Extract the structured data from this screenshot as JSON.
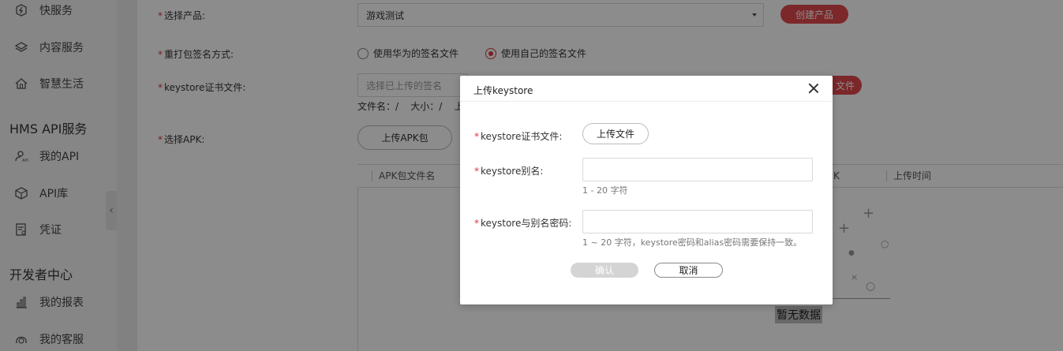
{
  "sidebar": {
    "items_top": [
      {
        "label": "快服务",
        "icon": "quick-service-icon"
      },
      {
        "label": "内容服务",
        "icon": "layers-icon"
      },
      {
        "label": "智慧生活",
        "icon": "home-icon"
      }
    ],
    "section_api": "HMS API服务",
    "items_api": [
      {
        "label": "我的API",
        "icon": "user-api-icon"
      },
      {
        "label": "API库",
        "icon": "cube-icon"
      },
      {
        "label": "凭证",
        "icon": "credential-icon"
      }
    ],
    "section_dev": "开发者中心",
    "items_dev": [
      {
        "label": "我的报表",
        "icon": "bar-chart-icon"
      },
      {
        "label": "我的客服",
        "icon": "headset-icon"
      }
    ],
    "collapse_glyph": "‹"
  },
  "form": {
    "product_label": "选择产品:",
    "product_value": "游戏测试",
    "create_product": "创建产品",
    "sign_method_label": "重打包签名方式:",
    "sign_option_huawei": "使用华为的签名文件",
    "sign_option_own": "使用自己的签名文件",
    "keystore_label": "keystore证书文件:",
    "keystore_placeholder": "选择已上传的签名",
    "upload_file_partial": "文件",
    "file_info": "文件名：/    大小：/    上",
    "apk_label": "选择APK:",
    "upload_apk": "上传APK包",
    "required_mark": "*"
  },
  "table": {
    "col_name": "APK包文件名",
    "col_partial": "K",
    "col_time": "上传时间",
    "empty_text": "暂无数据"
  },
  "modal": {
    "title": "上传keystore",
    "file_label": "keystore证书文件:",
    "upload_button": "上传文件",
    "alias_label": "keystore别名:",
    "alias_hint": "1 - 20 字符",
    "password_label": "keystore与别名密码:",
    "password_hint": "1 ~ 20 字符，keystore密码和alias密码需要保持一致。",
    "confirm": "确认",
    "cancel": "取消"
  },
  "colors": {
    "accent": "#e2474d",
    "required": "#d9383f"
  }
}
